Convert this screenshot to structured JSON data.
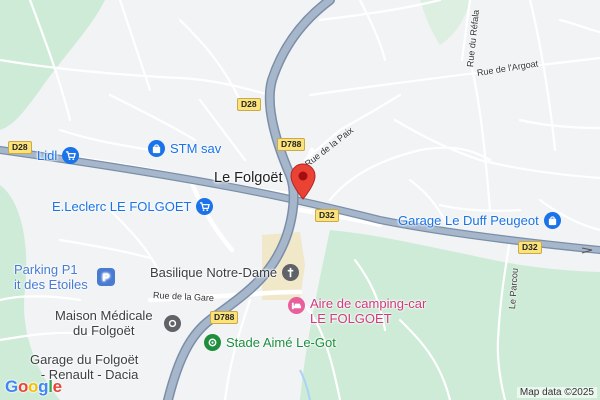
{
  "map": {
    "town_label": "Le Folgoët",
    "attribution": "Map data ©2025",
    "logo": {
      "letters": [
        "G",
        "o",
        "o",
        "g",
        "l",
        "e"
      ],
      "colors": [
        "#4285F4",
        "#EA4335",
        "#FBBC05",
        "#4285F4",
        "#34A853",
        "#EA4335"
      ]
    },
    "road_shields": {
      "d28_top": "D28",
      "d28_left": "D28",
      "d788_north": "D788",
      "d32_center": "D32",
      "d32_east": "D32",
      "d788_south": "D788"
    },
    "streets": {
      "rue_de_la_paix": "Rue de la Paix",
      "rue_de_largoat": "Rue de l'Argoat",
      "rue_du_refala": "Rue du Réfala",
      "rue_de_la_gare": "Rue de la Gare",
      "le_parcou": "Le Parcou"
    },
    "pois": {
      "lidl": "Lidl",
      "stm_sav": "STM sav",
      "eleclerc": "E.Leclerc LE FOLGOET",
      "parking_line1": "Parking P1",
      "parking_line2": "it des Etoiles",
      "garage_le_duff": "Garage Le Duff Peugeot",
      "basilique": "Basilique Notre-Dame",
      "maison_line1": "Maison Médicale",
      "maison_line2": "du Folgoët",
      "aire_line1": "Aire de camping-car",
      "aire_line2": "LE FOLGOET",
      "stade": "Stade Aimé Le-Got",
      "garage_folgoet_line1": "Garage du Folgoët",
      "garage_folgoet_line2": "- Renault - Dacia"
    },
    "colors": {
      "land": "#f1f3f5",
      "green": "#cdebd6",
      "major_road": "#8fa3bd",
      "minor_road": "#ffffff",
      "shopping": "#1a73e8",
      "parking": "#4a7bd3",
      "sights": "#5f6368",
      "hotel": "#e8609a",
      "sports": "#1e8e3e",
      "pin": "#ea4335"
    }
  }
}
